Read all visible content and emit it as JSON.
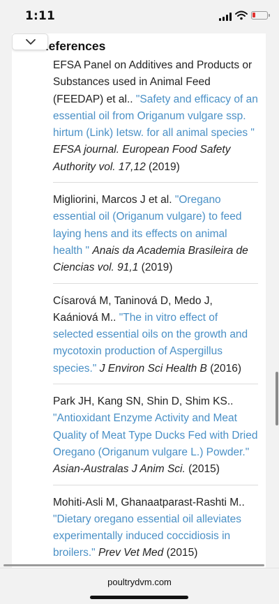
{
  "status_bar": {
    "time": "1:11",
    "signal_icon": "cellular-signal-icon",
    "wifi_icon": "wifi-icon",
    "battery_icon": "battery-low-icon",
    "battery_color": "#e0312f"
  },
  "toolbar": {
    "toggle_icon": "chevron-down-icon"
  },
  "section": {
    "heading": "References"
  },
  "colors": {
    "link": "#4a90c6",
    "text": "#222222"
  },
  "references": [
    {
      "authors": "EFSA Panel on Additives and Products or Substances used in Animal Feed (FEEDAP) et al.. ",
      "title": "\"Safety and efficacy of an essential oil from Origanum vulgare ssp. hirtum (Link) Ietsw. for all animal species \"",
      "journal": "EFSA journal. European Food Safety Authority vol. 17,12",
      "year": "(2019)"
    },
    {
      "authors": "Migliorini, Marcos J et al. ",
      "title": "\"Oregano essential oil (Origanum vulgare) to feed laying hens and its effects on animal health \"",
      "journal": "Anais da Academia Brasileira de Ciencias vol. 91,1",
      "year": "(2019)"
    },
    {
      "authors": "Císarová M, Taninová D, Medo J, Kaániová M.. ",
      "title": "\"The in vitro effect of selected essential oils on the growth and mycotoxin production of Aspergillus species.\"",
      "journal": "J Environ Sci Health B",
      "year": "(2016)"
    },
    {
      "authors": "Park JH, Kang SN, Shin D, Shim KS.. ",
      "title": "\"Antioxidant Enzyme Activity and Meat Quality of Meat Type Ducks Fed with Dried Oregano (Origanum vulgare L.) Powder.\"",
      "journal": "Asian-Australas J Anim Sci.",
      "year": "(2015)"
    },
    {
      "authors": "Mohiti-Asli M, Ghanaatparast-Rashti M.. ",
      "title": "\"Dietary oregano essential oil alleviates experimentally induced coccidiosis in broilers.\"",
      "journal": "Prev Vet Med",
      "year": "(2015)"
    }
  ],
  "browser": {
    "url": "poultrydvm.com"
  }
}
